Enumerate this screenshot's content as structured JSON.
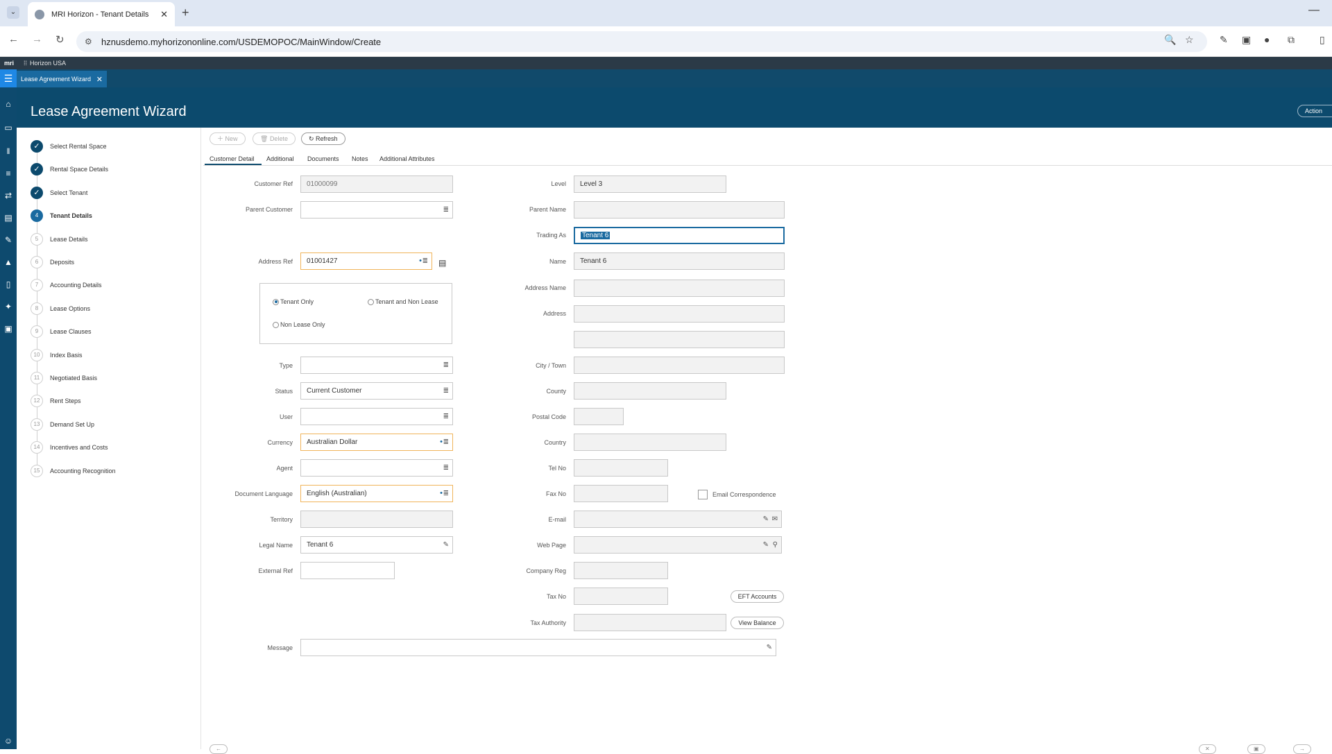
{
  "browser": {
    "tab_title": "MRI Horizon - Tenant Details",
    "url": "hznusdemo.myhorizononline.com/USDEMOPOC/MainWindow/Create"
  },
  "app": {
    "logo": "mri",
    "workspace": "Horizon USA",
    "window_tab": "Lease Agreement Wizard",
    "title": "Lease Agreement Wizard",
    "actions": "Action"
  },
  "steps": [
    {
      "num": "✓",
      "label": "Select Rental Space",
      "state": "done"
    },
    {
      "num": "✓",
      "label": "Rental Space Details",
      "state": "done"
    },
    {
      "num": "✓",
      "label": "Select Tenant",
      "state": "done"
    },
    {
      "num": "4",
      "label": "Tenant Details",
      "state": "current"
    },
    {
      "num": "5",
      "label": "Lease Details",
      "state": "todo"
    },
    {
      "num": "6",
      "label": "Deposits",
      "state": "todo"
    },
    {
      "num": "7",
      "label": "Accounting Details",
      "state": "todo"
    },
    {
      "num": "8",
      "label": "Lease Options",
      "state": "todo"
    },
    {
      "num": "9",
      "label": "Lease Clauses",
      "state": "todo"
    },
    {
      "num": "10",
      "label": "Index Basis",
      "state": "todo"
    },
    {
      "num": "11",
      "label": "Negotiated Basis",
      "state": "todo"
    },
    {
      "num": "12",
      "label": "Rent Steps",
      "state": "todo"
    },
    {
      "num": "13",
      "label": "Demand Set Up",
      "state": "todo"
    },
    {
      "num": "14",
      "label": "Incentives and Costs",
      "state": "todo"
    },
    {
      "num": "15",
      "label": "Accounting Recognition",
      "state": "todo"
    }
  ],
  "toolbar": {
    "new": "New",
    "delete": "Delete",
    "refresh": "Refresh"
  },
  "tabs": [
    "Customer Detail",
    "Additional",
    "Documents",
    "Notes",
    "Additional Attributes"
  ],
  "left_fields": {
    "customer_ref": {
      "label": "Customer Ref",
      "value": "01000099"
    },
    "parent_customer": {
      "label": "Parent Customer",
      "value": ""
    },
    "address_ref": {
      "label": "Address Ref",
      "value": "01001427"
    },
    "type": {
      "label": "Type",
      "value": ""
    },
    "status": {
      "label": "Status",
      "value": "Current Customer"
    },
    "user": {
      "label": "User",
      "value": ""
    },
    "currency": {
      "label": "Currency",
      "value": "Australian Dollar"
    },
    "agent": {
      "label": "Agent",
      "value": ""
    },
    "document_language": {
      "label": "Document Language",
      "value": "English (Australian)"
    },
    "territory": {
      "label": "Territory",
      "value": ""
    },
    "legal_name": {
      "label": "Legal Name",
      "value": "Tenant 6"
    },
    "external_ref": {
      "label": "External Ref",
      "value": ""
    },
    "message": {
      "label": "Message",
      "value": ""
    }
  },
  "radios": {
    "tenant_only": "Tenant Only",
    "tenant_and_non_lease": "Tenant and Non Lease",
    "non_lease_only": "Non Lease Only"
  },
  "right_fields": {
    "level": {
      "label": "Level",
      "value": "Level 3"
    },
    "parent_name": {
      "label": "Parent Name",
      "value": ""
    },
    "trading_as": {
      "label": "Trading As",
      "value": "Tenant 6"
    },
    "name": {
      "label": "Name",
      "value": "Tenant 6"
    },
    "address_name": {
      "label": "Address Name",
      "value": ""
    },
    "address": {
      "label": "Address",
      "value": ""
    },
    "city_town": {
      "label": "City / Town",
      "value": ""
    },
    "county": {
      "label": "County",
      "value": ""
    },
    "postal_code": {
      "label": "Postal Code",
      "value": ""
    },
    "country": {
      "label": "Country",
      "value": ""
    },
    "tel_no": {
      "label": "Tel No",
      "value": ""
    },
    "fax_no": {
      "label": "Fax No",
      "value": ""
    },
    "email": {
      "label": "E-mail",
      "value": ""
    },
    "web_page": {
      "label": "Web Page",
      "value": ""
    },
    "company_reg": {
      "label": "Company Reg",
      "value": ""
    },
    "tax_no": {
      "label": "Tax No",
      "value": ""
    },
    "tax_authority": {
      "label": "Tax Authority",
      "value": ""
    }
  },
  "email_correspondence": "Email Correspondence",
  "buttons": {
    "eft_accounts": "EFT Accounts",
    "view_balance": "View Balance"
  }
}
